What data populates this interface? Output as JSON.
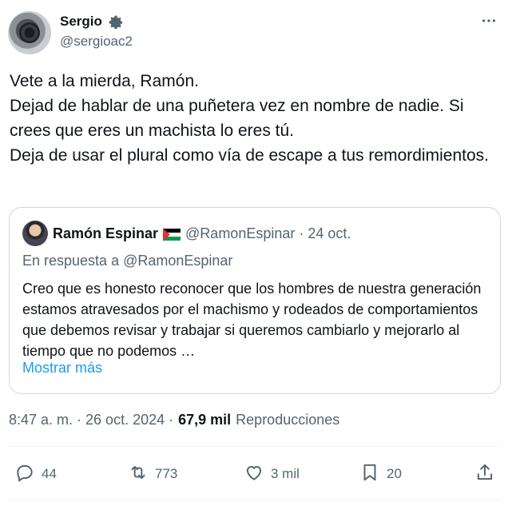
{
  "author": {
    "name": "Sergio",
    "handle": "@sergioac2",
    "badge_icon": "gear-icon"
  },
  "more_icon": "more-icon",
  "tweet_text": [
    "Vete a la mierda, Ramón.",
    "Dejad de hablar de una puñetera vez en nombre de nadie. Si crees que eres un machista lo eres tú.",
    "Deja de usar el plural como vía de escape a tus remordimientos."
  ],
  "quote": {
    "name": "Ramón Espinar",
    "flag_icon": "palestine-flag-icon",
    "handle_date": "@RamonEspinar · 24 oct.",
    "in_reply": "En respuesta a @RamonEspinar",
    "text": "Creo que es honesto reconocer que los hombres de nuestra generación estamos atravesados por el machismo y rodeados de comportamientos que debemos revisar y trabajar si queremos cambiarlo y mejorarlo al tiempo que no podemos …",
    "show_more": "Mostrar más"
  },
  "meta": {
    "timestamp": "8:47 a. m. · 26 oct. 2024 ·",
    "views_count": "67,9 mil",
    "views_label": "Reproducciones"
  },
  "actions": {
    "replies": "44",
    "retweets": "773",
    "likes": "3 mil",
    "bookmarks": "20"
  },
  "colors": {
    "text": "#0f1419",
    "secondary": "#536471",
    "link": "#1d9bf0",
    "border": "#cfd9de"
  }
}
